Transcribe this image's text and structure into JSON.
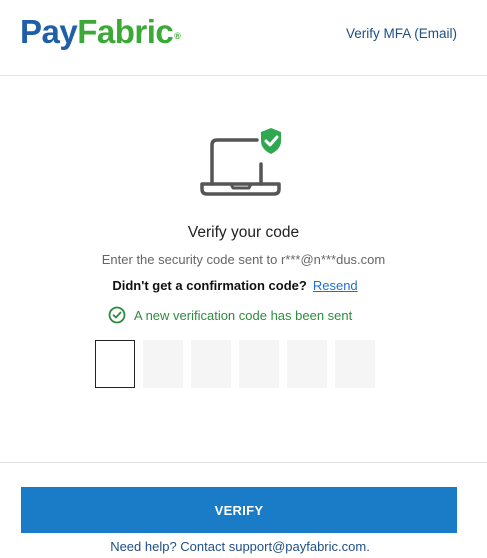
{
  "header": {
    "logo_pay": "Pay",
    "logo_fabric": "Fabric",
    "logo_reg": "®",
    "title": "Verify MFA (Email)"
  },
  "main": {
    "icon": "laptop-shield-check-icon",
    "heading": "Verify your code",
    "subtitle": "Enter the security code sent to r***@n***dus.com",
    "resend_prompt": "Didn't get a confirmation code?",
    "resend_link": "Resend",
    "notice": "A new verification code has been sent",
    "code_fields": [
      "",
      "",
      "",
      "",
      "",
      ""
    ]
  },
  "footer": {
    "verify_label": "VERIFY",
    "help_text": "Need help? Contact support@payfabric.com."
  },
  "colors": {
    "brand_blue": "#1f5fa8",
    "brand_green": "#3aa935",
    "button": "#1a7bc6",
    "success": "#2e8b3e",
    "link": "#1e6fd9"
  }
}
